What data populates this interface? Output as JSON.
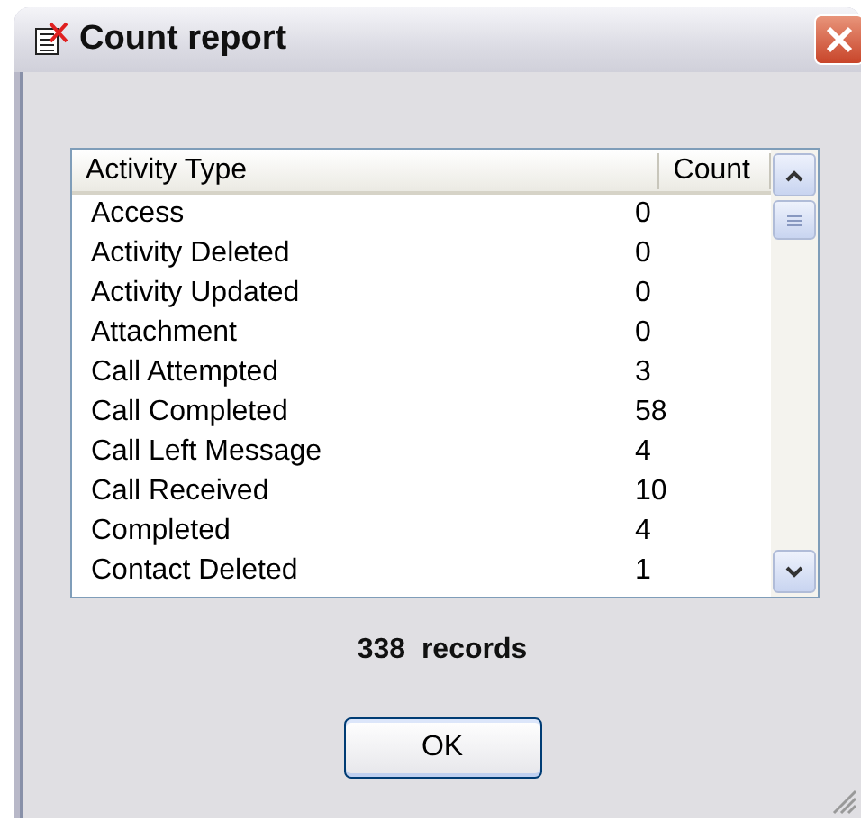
{
  "window": {
    "title": "Count report"
  },
  "table": {
    "columns": [
      "Activity Type",
      "Count"
    ],
    "rows": [
      {
        "activity_type": "Access",
        "count": "0"
      },
      {
        "activity_type": "Activity Deleted",
        "count": "0"
      },
      {
        "activity_type": "Activity Updated",
        "count": "0"
      },
      {
        "activity_type": "Attachment",
        "count": "0"
      },
      {
        "activity_type": "Call Attempted",
        "count": "3"
      },
      {
        "activity_type": "Call Completed",
        "count": "58"
      },
      {
        "activity_type": "Call Left Message",
        "count": "4"
      },
      {
        "activity_type": "Call Received",
        "count": "10"
      },
      {
        "activity_type": "Completed",
        "count": "4"
      },
      {
        "activity_type": "Contact Deleted",
        "count": "1"
      }
    ]
  },
  "summary": "338  records",
  "buttons": [
    "OK"
  ]
}
